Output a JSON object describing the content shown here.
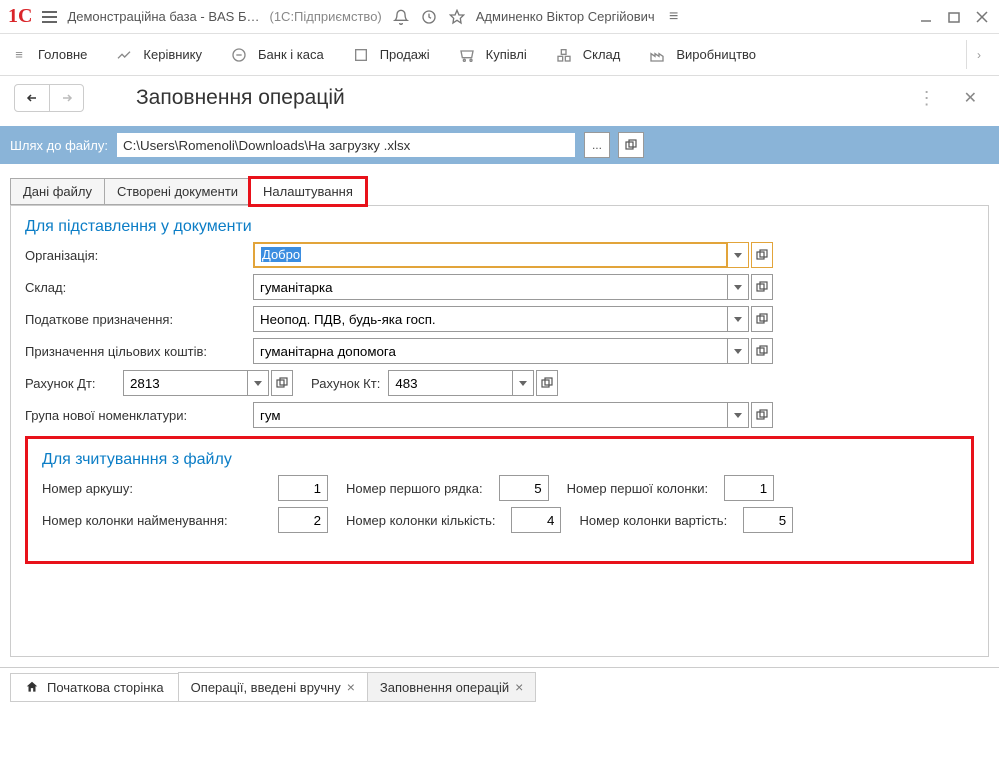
{
  "title": {
    "app": "Демонстраційна база - BAS Б…",
    "platform": "(1С:Підприємство)",
    "user": "Админенко Віктор Сергійович"
  },
  "nav": {
    "items": [
      {
        "label": "Головне"
      },
      {
        "label": "Керівнику"
      },
      {
        "label": "Банк і каса"
      },
      {
        "label": "Продажі"
      },
      {
        "label": "Купівлі"
      },
      {
        "label": "Склад"
      },
      {
        "label": "Виробництво"
      }
    ]
  },
  "page": {
    "title": "Заповнення операцій"
  },
  "path": {
    "label": "Шлях до файлу:",
    "value": "C:\\Users\\Romenoli\\Downloads\\На загрузку .xlsx",
    "dots": "..."
  },
  "tabs": {
    "t1": "Дані файлу",
    "t2": "Створені документи",
    "t3": "Налаштування"
  },
  "sect1": {
    "title": "Для підставлення у документи",
    "org_lbl": "Організація:",
    "org_val": "Добро",
    "wh_lbl": "Склад:",
    "wh_val": "гуманітарка",
    "tax_lbl": "Податкове призначення:",
    "tax_val": "Неопод. ПДВ, будь-яка госп.",
    "tgt_lbl": "Призначення цільових коштів:",
    "tgt_val": "гуманітарна допомога",
    "acc_dt_lbl": "Рахунок Дт:",
    "acc_dt_val": "2813",
    "acc_kt_lbl": "Рахунок Кт:",
    "acc_kt_val": "483",
    "grp_lbl": "Група нової номенклатури:",
    "grp_val": "гум"
  },
  "sect2": {
    "title": "Для зчитуванння з файлу",
    "sheet_lbl": "Номер аркушу:",
    "sheet_val": "1",
    "row_lbl": "Номер першого рядка:",
    "row_val": "5",
    "col_lbl": "Номер першої колонки:",
    "col_val": "1",
    "name_lbl": "Номер колонки найменування:",
    "name_val": "2",
    "qty_lbl": "Номер колонки кількість:",
    "qty_val": "4",
    "cost_lbl": "Номер колонки вартість:",
    "cost_val": "5"
  },
  "doctabs": {
    "home": "Початкова сторінка",
    "t1": "Операції, введені вручну",
    "t2": "Заповнення операцій"
  }
}
